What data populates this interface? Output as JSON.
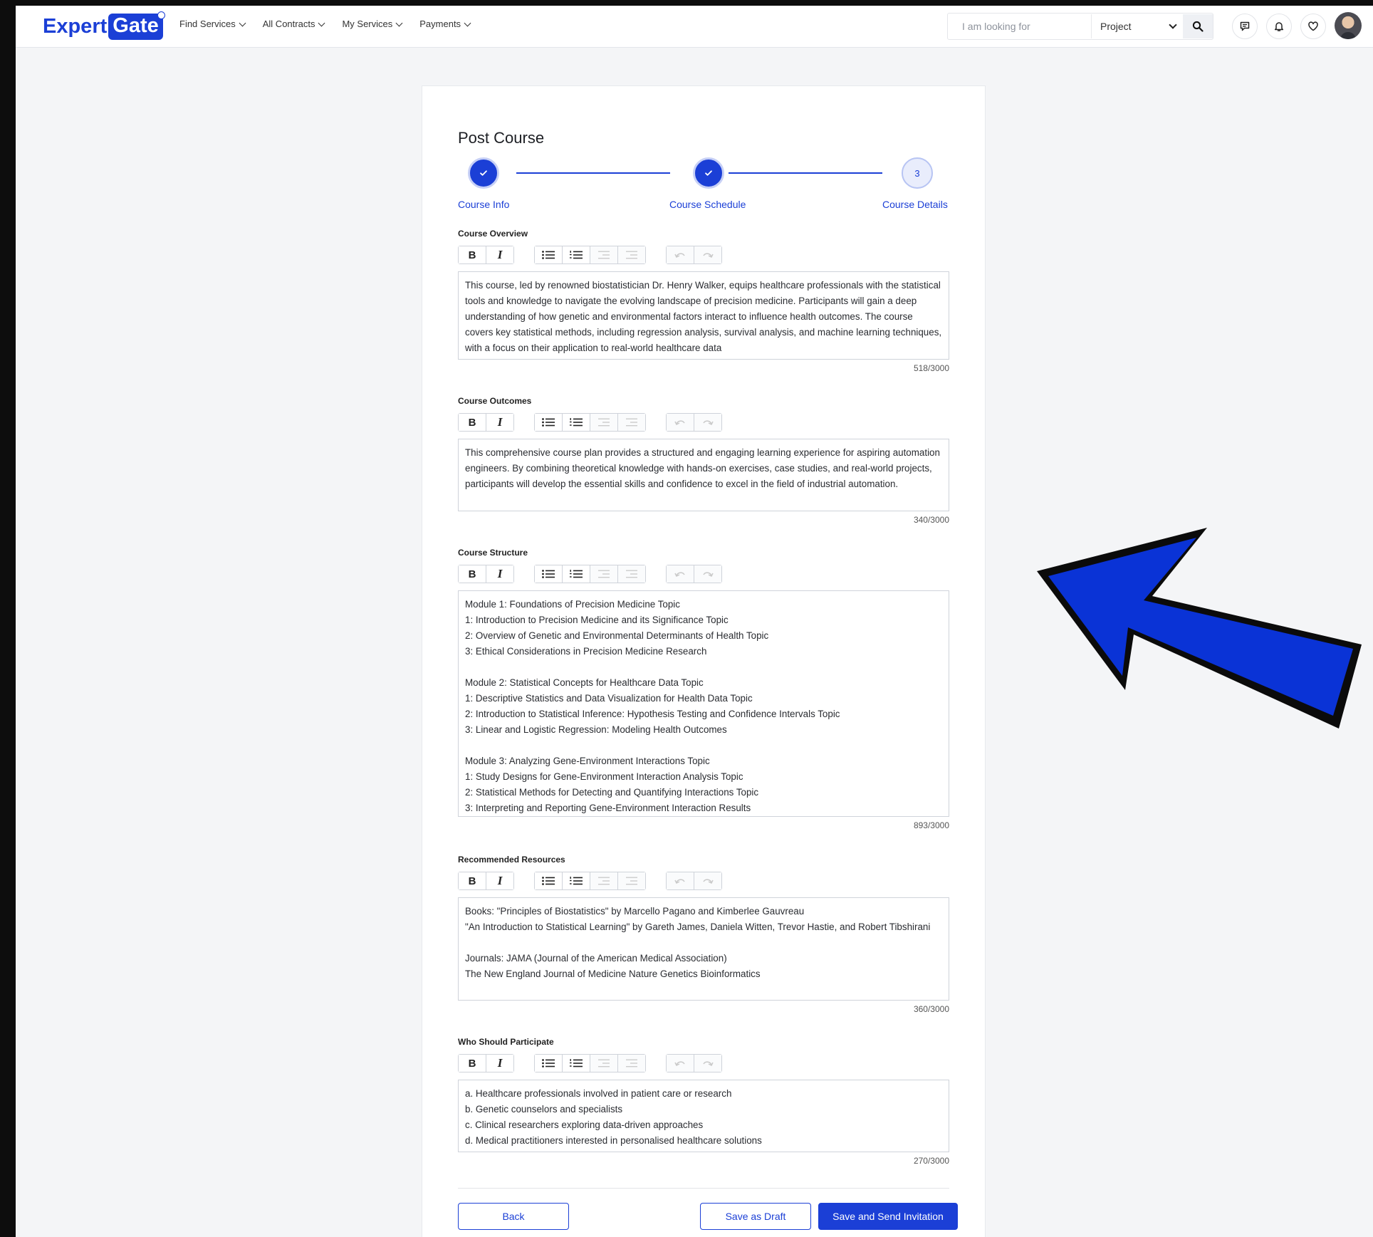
{
  "header": {
    "logo_part1": "Expert",
    "logo_part2": "Gate",
    "nav": [
      "Find Services",
      "All Contracts",
      "My Services",
      "Payments"
    ],
    "search_placeholder": "I am looking for",
    "search_type": "Project"
  },
  "page": {
    "title": "Post Course",
    "steps": [
      {
        "label": "Course Info",
        "state": "done"
      },
      {
        "label": "Course Schedule",
        "state": "done"
      },
      {
        "label": "Course Details",
        "number": "3",
        "state": "current"
      }
    ]
  },
  "sections": [
    {
      "label": "Course Overview",
      "text": "This course, led by renowned biostatistician Dr. Henry Walker, equips healthcare professionals with the statistical tools and knowledge to navigate the evolving landscape of precision medicine. Participants will gain a deep understanding of how genetic and environmental factors interact to influence health outcomes. The course covers key statistical methods, including regression analysis, survival analysis, and machine learning techniques, with a focus on their application to real-world healthcare data",
      "counter": "518/3000"
    },
    {
      "label": "Course Outcomes",
      "text": "This comprehensive course plan provides a structured and engaging learning experience for aspiring automation engineers. By combining theoretical knowledge with hands-on exercises, case studies, and real-world projects, participants will develop the essential skills and confidence to excel in the field of industrial automation.",
      "counter": "340/3000"
    },
    {
      "label": "Course Structure",
      "text": " Module 1: Foundations of Precision Medicine Topic\n1: Introduction to Precision Medicine and its Significance Topic\n2: Overview of Genetic and Environmental Determinants of Health Topic\n3: Ethical Considerations in Precision Medicine Research\n\nModule 2: Statistical Concepts for Healthcare Data Topic\n1: Descriptive Statistics and Data Visualization for Health Data Topic\n2: Introduction to Statistical Inference: Hypothesis Testing and Confidence Intervals Topic\n3: Linear and Logistic Regression: Modeling Health Outcomes\n\nModule 3: Analyzing Gene-Environment Interactions Topic\n1: Study Designs for Gene-Environment Interaction Analysis Topic\n2: Statistical Methods for Detecting and Quantifying Interactions Topic\n3: Interpreting and Reporting Gene-Environment Interaction Results",
      "counter": "893/3000"
    },
    {
      "label": "Recommended Resources",
      "text": "Books: \"Principles of Biostatistics\" by Marcello Pagano and Kimberlee Gauvreau\n\"An Introduction to Statistical Learning\" by Gareth James, Daniela Witten, Trevor Hastie, and Robert Tibshirani\n\nJournals: JAMA (Journal of the American Medical Association)\nThe New England Journal of Medicine Nature Genetics Bioinformatics",
      "counter": "360/3000"
    },
    {
      "label": "Who Should Participate",
      "text": "a. Healthcare professionals involved in patient care or research\nb. Genetic counselors and specialists\nc. Clinical researchers exploring data-driven approaches\nd. Medical practitioners interested in personalised healthcare solutions",
      "counter": "270/3000"
    }
  ],
  "actions": {
    "back": "Back",
    "save_draft": "Save as Draft",
    "save_send": "Save and Send Invitation"
  },
  "colors": {
    "brand": "#1b3fd6",
    "arrow": "#0a33d6"
  }
}
